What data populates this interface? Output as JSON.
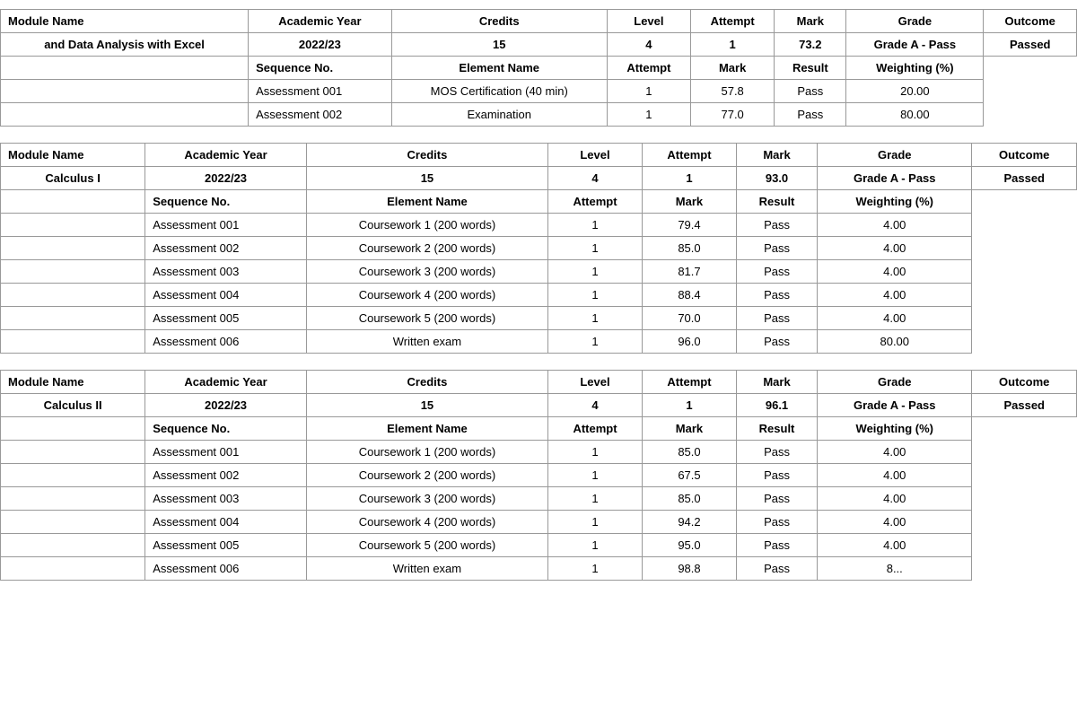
{
  "modules": [
    {
      "name": "and Data Analysis with Excel",
      "academic_year": "2022/23",
      "credits": "15",
      "level": "4",
      "attempt": "1",
      "mark": "73.2",
      "grade": "Grade A - Pass",
      "outcome": "Passed",
      "assessments": [
        {
          "seq": "Assessment 001",
          "element": "MOS Certification (40 min)",
          "attempt": "1",
          "mark": "57.8",
          "result": "Pass",
          "weighting": "20.00"
        },
        {
          "seq": "Assessment 002",
          "element": "Examination",
          "attempt": "1",
          "mark": "77.0",
          "result": "Pass",
          "weighting": "80.00"
        }
      ]
    },
    {
      "name": "Calculus I",
      "academic_year": "2022/23",
      "credits": "15",
      "level": "4",
      "attempt": "1",
      "mark": "93.0",
      "grade": "Grade A - Pass",
      "outcome": "Passed",
      "assessments": [
        {
          "seq": "Assessment 001",
          "element": "Coursework 1 (200 words)",
          "attempt": "1",
          "mark": "79.4",
          "result": "Pass",
          "weighting": "4.00"
        },
        {
          "seq": "Assessment 002",
          "element": "Coursework 2 (200 words)",
          "attempt": "1",
          "mark": "85.0",
          "result": "Pass",
          "weighting": "4.00"
        },
        {
          "seq": "Assessment 003",
          "element": "Coursework 3 (200 words)",
          "attempt": "1",
          "mark": "81.7",
          "result": "Pass",
          "weighting": "4.00"
        },
        {
          "seq": "Assessment 004",
          "element": "Coursework 4 (200 words)",
          "attempt": "1",
          "mark": "88.4",
          "result": "Pass",
          "weighting": "4.00"
        },
        {
          "seq": "Assessment 005",
          "element": "Coursework 5 (200 words)",
          "attempt": "1",
          "mark": "70.0",
          "result": "Pass",
          "weighting": "4.00"
        },
        {
          "seq": "Assessment 006",
          "element": "Written exam",
          "attempt": "1",
          "mark": "96.0",
          "result": "Pass",
          "weighting": "80.00"
        }
      ]
    },
    {
      "name": "Calculus II",
      "academic_year": "2022/23",
      "credits": "15",
      "level": "4",
      "attempt": "1",
      "mark": "96.1",
      "grade": "Grade A - Pass",
      "outcome": "Passed",
      "assessments": [
        {
          "seq": "Assessment 001",
          "element": "Coursework 1 (200 words)",
          "attempt": "1",
          "mark": "85.0",
          "result": "Pass",
          "weighting": "4.00"
        },
        {
          "seq": "Assessment 002",
          "element": "Coursework 2 (200 words)",
          "attempt": "1",
          "mark": "67.5",
          "result": "Pass",
          "weighting": "4.00"
        },
        {
          "seq": "Assessment 003",
          "element": "Coursework 3 (200 words)",
          "attempt": "1",
          "mark": "85.0",
          "result": "Pass",
          "weighting": "4.00"
        },
        {
          "seq": "Assessment 004",
          "element": "Coursework 4 (200 words)",
          "attempt": "1",
          "mark": "94.2",
          "result": "Pass",
          "weighting": "4.00"
        },
        {
          "seq": "Assessment 005",
          "element": "Coursework 5 (200 words)",
          "attempt": "1",
          "mark": "95.0",
          "result": "Pass",
          "weighting": "4.00"
        },
        {
          "seq": "Assessment 006",
          "element": "Written exam",
          "attempt": "1",
          "mark": "98.8",
          "result": "Pass",
          "weighting": "8..."
        }
      ]
    }
  ],
  "headers": {
    "module_name": "Module Name",
    "academic_year": "Academic Year",
    "credits": "Credits",
    "level": "Level",
    "attempt": "Attempt",
    "mark": "Mark",
    "grade": "Grade",
    "outcome": "Outcome",
    "sequence_no": "Sequence No.",
    "element_name": "Element Name",
    "result": "Result",
    "weighting": "Weighting (%)"
  }
}
